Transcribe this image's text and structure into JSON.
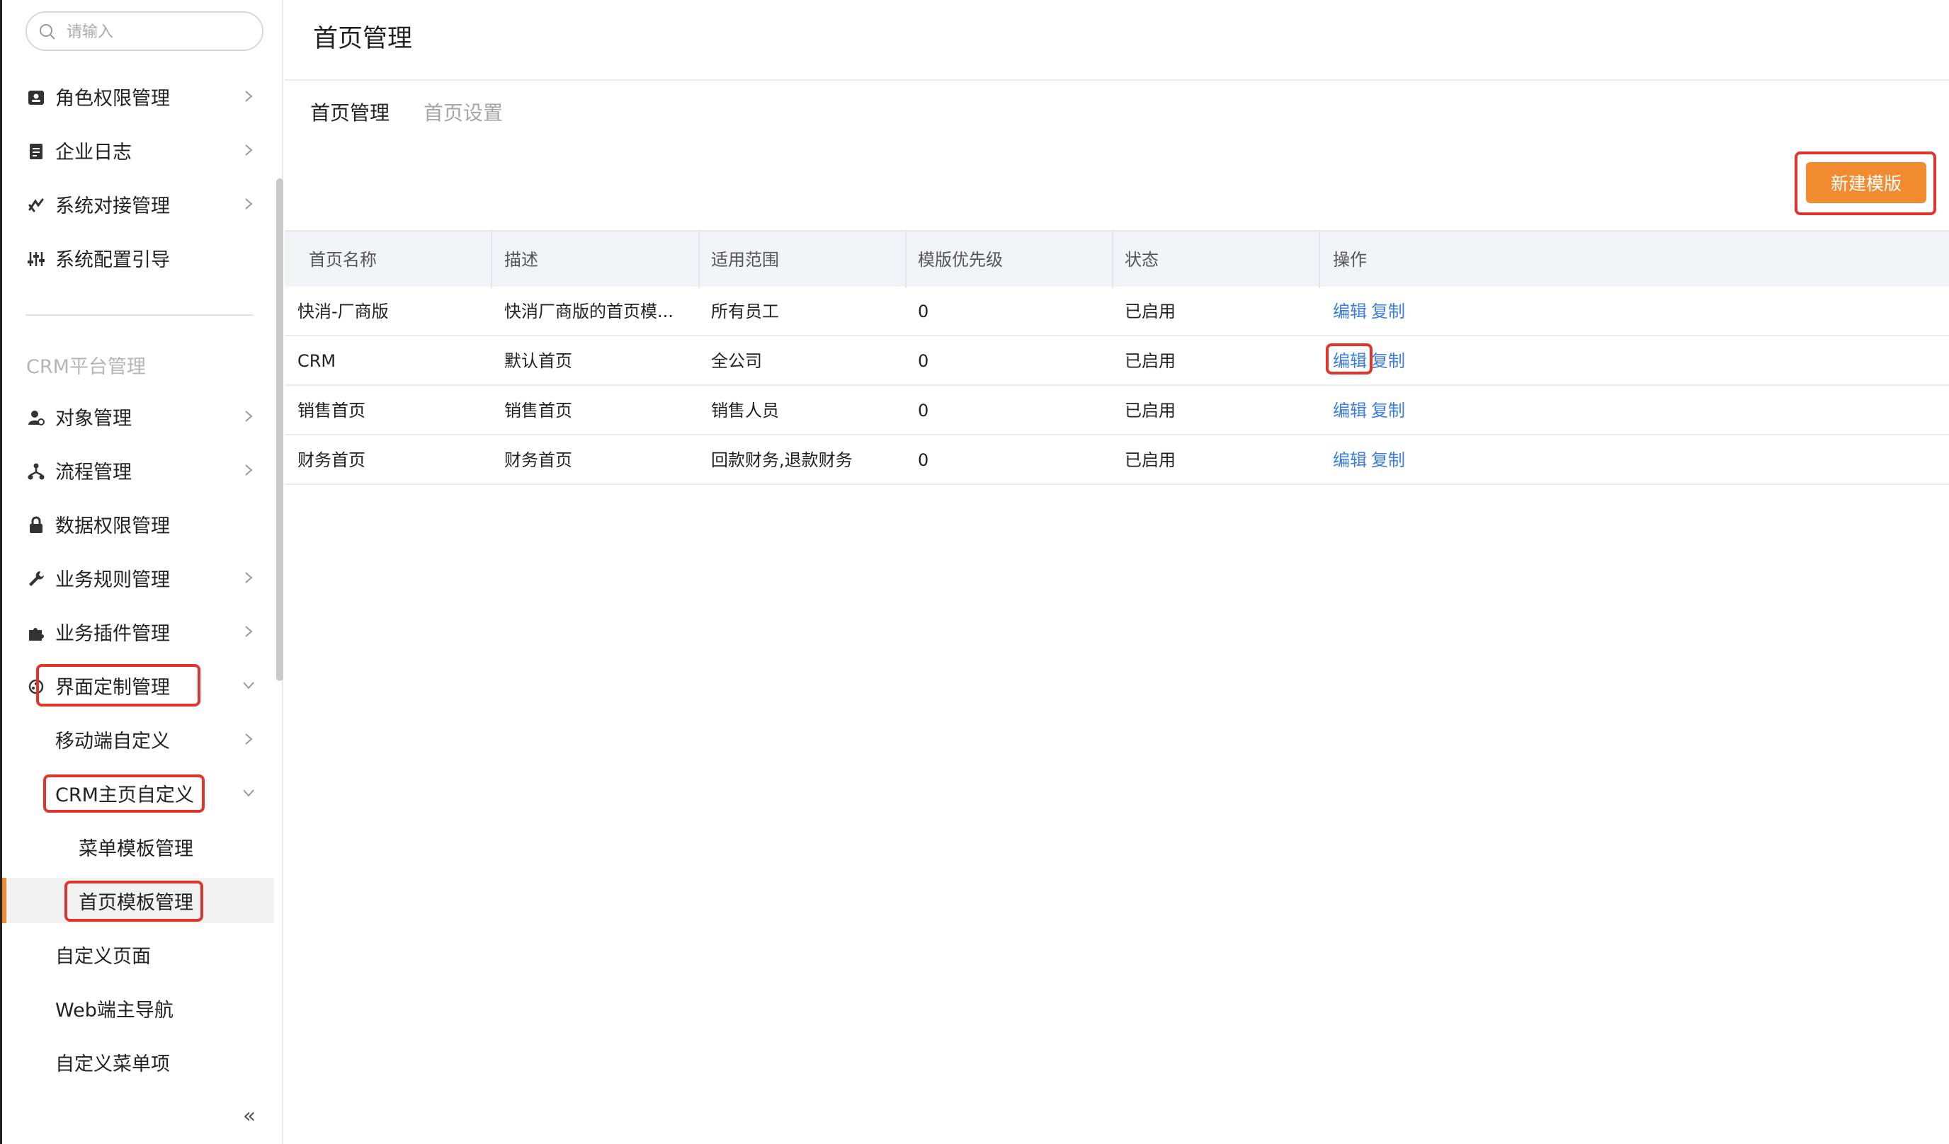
{
  "sidebar": {
    "search_placeholder": "请输入",
    "items_top": [
      {
        "label": "角色权限管理"
      },
      {
        "label": "企业日志"
      },
      {
        "label": "系统对接管理"
      },
      {
        "label": "系统配置引导"
      }
    ],
    "section_title": "CRM平台管理",
    "items_crm": [
      {
        "label": "对象管理"
      },
      {
        "label": "流程管理"
      },
      {
        "label": "数据权限管理"
      },
      {
        "label": "业务规则管理"
      },
      {
        "label": "业务插件管理"
      },
      {
        "label": "界面定制管理"
      }
    ],
    "sub_items": [
      {
        "label": "移动端自定义"
      },
      {
        "label": "CRM主页自定义"
      }
    ],
    "sub2_items": [
      {
        "label": "菜单模板管理"
      },
      {
        "label": "首页模板管理"
      }
    ],
    "tail_items": [
      {
        "label": "自定义页面"
      },
      {
        "label": "Web端主导航"
      },
      {
        "label": "自定义菜单项"
      }
    ],
    "collapse_glyph": "«"
  },
  "main": {
    "page_title": "首页管理",
    "tabs": [
      {
        "label": "首页管理"
      },
      {
        "label": "首页设置"
      }
    ],
    "new_button": "新建模版",
    "columns": [
      "首页名称",
      "描述",
      "适用范围",
      "模版优先级",
      "状态",
      "操作"
    ],
    "rows": [
      {
        "name": "快消-厂商版",
        "desc": "快消厂商版的首页模...",
        "scope": "所有员工",
        "priority": "0",
        "status": "已启用",
        "edit": "编辑",
        "copy": "复制"
      },
      {
        "name": "CRM",
        "desc": "默认首页",
        "scope": "全公司",
        "priority": "0",
        "status": "已启用",
        "edit": "编辑",
        "copy": "复制"
      },
      {
        "name": "销售首页",
        "desc": "销售首页",
        "scope": "销售人员",
        "priority": "0",
        "status": "已启用",
        "edit": "编辑",
        "copy": "复制"
      },
      {
        "name": "财务首页",
        "desc": "财务首页",
        "scope": "回款财务,退款财务",
        "priority": "0",
        "status": "已启用",
        "edit": "编辑",
        "copy": "复制"
      }
    ]
  },
  "colors": {
    "accent": "#f28b30",
    "highlight": "#e0352b",
    "link": "#3b7ddd"
  }
}
